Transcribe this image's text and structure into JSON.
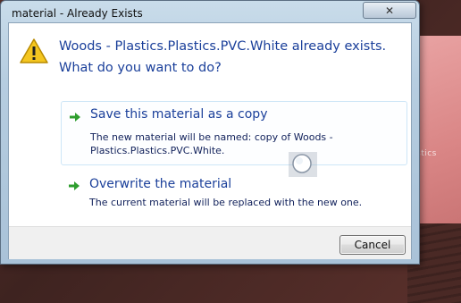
{
  "window": {
    "title": "material - Already Exists",
    "close_glyph": "✕"
  },
  "message": {
    "text": "Woods - Plastics.Plastics.PVC.White already exists.  What do you want to do?"
  },
  "options": [
    {
      "title": "Save this material as a copy",
      "description": "The new material will be named:  copy of Woods - Plastics.Plastics.PVC.White."
    },
    {
      "title": "Overwrite the material",
      "description": "The current material will be replaced with the new one."
    }
  ],
  "footer": {
    "cancel_label": "Cancel"
  },
  "background": {
    "label": "stics"
  },
  "icons": {
    "warning": "warning-icon",
    "option_arrow": "green-arrow-icon",
    "cursor": "busy-cursor-icon"
  },
  "colors": {
    "accent_text": "#1a3f9a",
    "arrow": "#2e9e2e",
    "warning_fill": "#f4c620"
  }
}
